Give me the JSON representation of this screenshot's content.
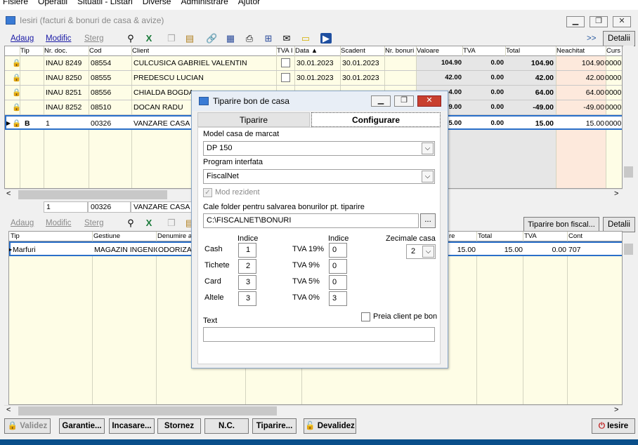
{
  "menu": [
    "Fisiere",
    "Operatii",
    "Situatii - Listari",
    "Diverse",
    "Administrare",
    "Ajutor"
  ],
  "window": {
    "title": "Iesiri (facturi & bonuri de casa & avize)"
  },
  "toolbar_top": {
    "add": "Adaug",
    "modify": "Modific",
    "delete": "Sterg",
    "more": ">>",
    "details": "Detalii"
  },
  "top_table": {
    "columns": [
      "Tip",
      "Nr. doc.",
      "Cod",
      "Client",
      "TVA I",
      "Data",
      "Scadent",
      "Nr. bonuri",
      "Valoare",
      "TVA",
      "Total",
      "Neachitat",
      "Curs"
    ],
    "rows": [
      {
        "tip": "",
        "nr": "INAU 8249",
        "cod": "08554",
        "client": "CULCUSICA GABRIEL VALENTIN",
        "data": "30.01.2023",
        "scadent": "30.01.2023",
        "valoare": "104.90",
        "tva": "0.00",
        "total": "104.90",
        "neachitat": "104.90",
        "curs": "0000"
      },
      {
        "tip": "",
        "nr": "INAU 8250",
        "cod": "08555",
        "client": "PREDESCU LUCIAN",
        "data": "30.01.2023",
        "scadent": "30.01.2023",
        "valoare": "42.00",
        "tva": "0.00",
        "total": "42.00",
        "neachitat": "42.00",
        "curs": "0000"
      },
      {
        "tip": "",
        "nr": "INAU 8251",
        "cod": "08556",
        "client": "CHIALDA BOGDA",
        "data": "",
        "scadent": "",
        "valoare": "4.00",
        "tva": "0.00",
        "total": "64.00",
        "neachitat": "64.00",
        "curs": "0000"
      },
      {
        "tip": "",
        "nr": "INAU 8252",
        "cod": "08510",
        "client": "DOCAN RADU",
        "data": "",
        "scadent": "",
        "valoare": "9.00",
        "tva": "0.00",
        "total": "-49.00",
        "neachitat": "-49.00",
        "curs": "0000"
      },
      {
        "tip": "B",
        "nr": "1",
        "cod": "00326",
        "client": "VANZARE CASA",
        "data": "",
        "scadent": "",
        "valoare": "5.00",
        "tva": "0.00",
        "total": "15.00",
        "neachitat": "15.00",
        "curs": "0000"
      }
    ]
  },
  "mid_strip": {
    "nr": "1",
    "cod": "00326",
    "client": "VANZARE CASA M"
  },
  "toolbar_bottom": {
    "add": "Adaug",
    "modify": "Modific",
    "delete": "Sterg",
    "print_fiscal": "Tiparire bon fiscal...",
    "details": "Detalii"
  },
  "bottom_table": {
    "columns": [
      "Tip",
      "Gestiune",
      "Denumire a",
      "re",
      "Total",
      "TVA",
      "Cont"
    ],
    "row": {
      "tip": "Marfuri",
      "gestiune": "MAGAZIN INGENIC",
      "denumire": "ODORIZA",
      "pret": "15.00",
      "total": "15.00",
      "tva": "0.00",
      "cont": "707"
    }
  },
  "bottom_buttons": {
    "validate": "Validez",
    "warranty": "Garantie...",
    "cashing": "Incasare...",
    "reverse": "Stornez",
    "nc": "N.C.",
    "print": "Tiparire...",
    "invalidate": "Devalidez",
    "exit": "Iesire"
  },
  "dialog": {
    "title": "Tiparire bon de casa",
    "tabs": [
      "Tiparire",
      "Configurare"
    ],
    "model_label": "Model casa de marcat",
    "model_value": "DP 150",
    "program_label": "Program interfata",
    "program_value": "FiscalNet",
    "resident_label": "Mod rezident",
    "folder_label": "Cale folder pentru salvarea bonurilor pt. tiparire",
    "folder_value": "C:\\FISCALNET\\BONURI",
    "folder_button": "...",
    "index_header": "Indice",
    "index_header2": "Indice",
    "decimals_label": "Zecimale casa",
    "decimals_value": "2",
    "payments": [
      {
        "label": "Cash",
        "value": "1"
      },
      {
        "label": "Tichete",
        "value": "2"
      },
      {
        "label": "Card",
        "value": "3"
      },
      {
        "label": "Altele",
        "value": "3"
      }
    ],
    "vats": [
      {
        "label": "TVA 19%",
        "value": "0"
      },
      {
        "label": "TVA 9%",
        "value": "0"
      },
      {
        "label": "TVA 5%",
        "value": "0"
      },
      {
        "label": "TVA 0%",
        "value": "3"
      }
    ],
    "take_client_label": "Preia client pe bon",
    "text_label": "Text",
    "text_value": ""
  }
}
